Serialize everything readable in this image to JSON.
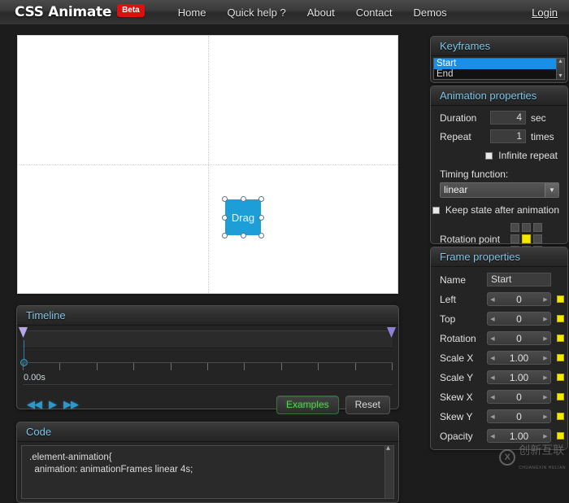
{
  "nav": {
    "brand": "CSS Animate",
    "beta_badge": "Beta",
    "links": [
      "Home",
      "Quick help ?",
      "About",
      "Contact",
      "Demos"
    ],
    "login": "Login"
  },
  "stage": {
    "element_label": "Drag"
  },
  "keyframes": {
    "title": "Keyframes",
    "items": [
      "Start",
      "End"
    ],
    "selected": "Start"
  },
  "animation": {
    "title": "Animation properties",
    "duration_label": "Duration",
    "duration_value": "4",
    "duration_unit": "sec",
    "repeat_label": "Repeat",
    "repeat_value": "1",
    "repeat_unit": "times",
    "infinite_label": "Infinite repeat",
    "timing_label": "Timing function:",
    "timing_value": "linear",
    "keep_state_label": "Keep state after animation",
    "rotation_label": "Rotation point",
    "rotation_active_cell": 4
  },
  "frame": {
    "title": "Frame properties",
    "name_label": "Name",
    "name_value": "Start",
    "rows": [
      {
        "label": "Left",
        "value": "0"
      },
      {
        "label": "Top",
        "value": "0"
      },
      {
        "label": "Rotation",
        "value": "0"
      },
      {
        "label": "Scale X",
        "value": "1.00"
      },
      {
        "label": "Scale Y",
        "value": "1.00"
      },
      {
        "label": "Skew X",
        "value": "0"
      },
      {
        "label": "Skew Y",
        "value": "0"
      },
      {
        "label": "Opacity",
        "value": "1.00"
      }
    ]
  },
  "timeline": {
    "title": "Timeline",
    "current_time": "0.00s",
    "rewind_icon": "◀◀",
    "play_icon": "▶",
    "forward_icon": "▶▶",
    "examples_label": "Examples",
    "reset_label": "Reset"
  },
  "code": {
    "title": "Code",
    "content": ".element-animation{\n  animation: animationFrames linear 4s;"
  },
  "watermark": {
    "mark": "X",
    "text": "创新互联",
    "sub": "CHUANGXIN HULIAN"
  },
  "colors": {
    "accent_blue": "#1e9ed6",
    "panel_title": "#7fc6e8",
    "beta_red": "#d81111",
    "select_blue": "#1a8fe8",
    "rotation_yellow": "#f5e800",
    "examples_green": "#4fd14f"
  }
}
